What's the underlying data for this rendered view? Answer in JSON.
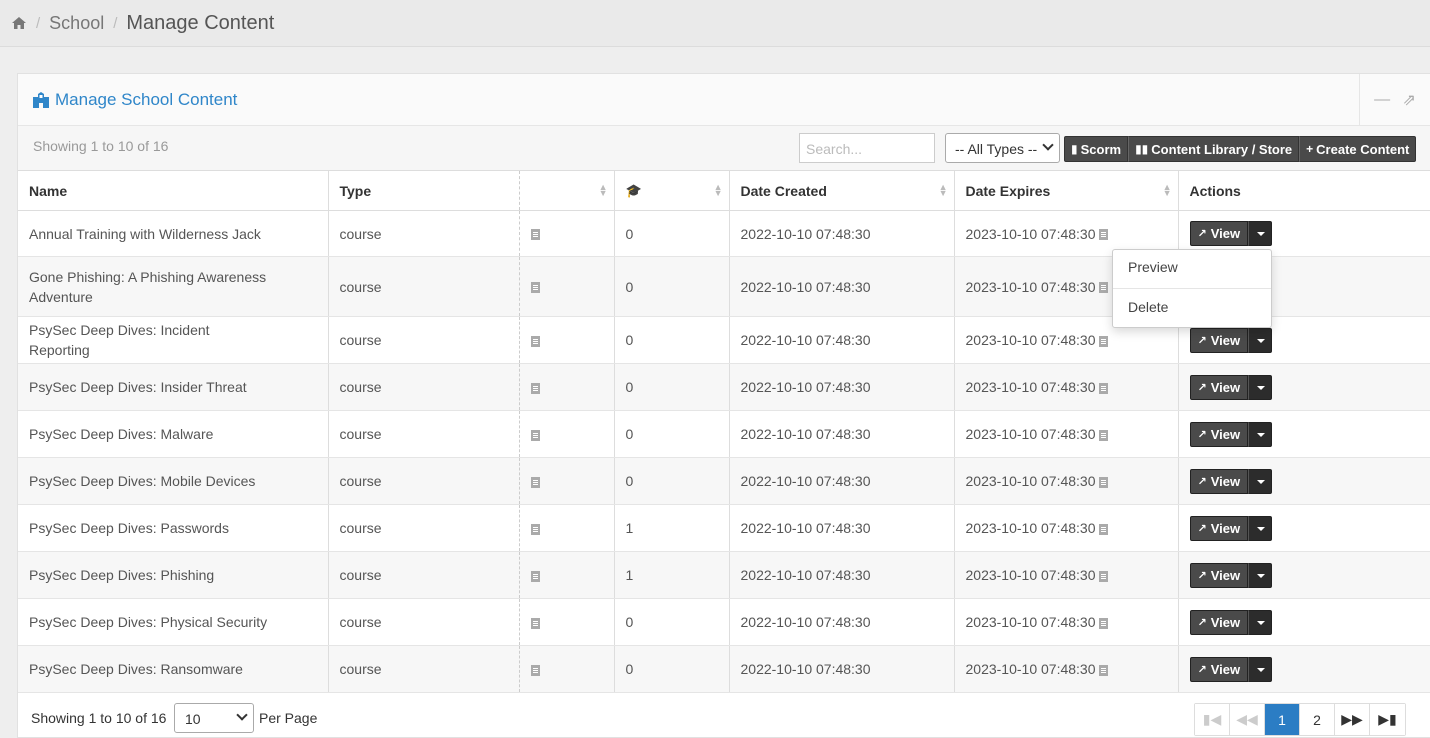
{
  "breadcrumb": {
    "items": [
      "School",
      "Manage Content"
    ]
  },
  "panel": {
    "title": "Manage School Content",
    "minimize_icon": "minus-icon",
    "compress_icon": "compress-icon"
  },
  "toolbar": {
    "showing": "Showing 1 to 10 of 16",
    "search_placeholder": "Search...",
    "type_filter": "-- All Types --",
    "buttons": [
      "Scorm",
      "Content Library / Store",
      "Create Content"
    ]
  },
  "table": {
    "headers": {
      "name": "Name",
      "type": "Type",
      "file": "",
      "enrolled_icon": "graduation-cap-icon",
      "date_created": "Date Created",
      "date_expires": "Date Expires",
      "actions": "Actions"
    },
    "view_label": "View",
    "rows": [
      {
        "name": "Annual Training with Wilderness Jack",
        "type": "course",
        "count": "0",
        "created": "2022-10-10 07:48:30",
        "expires": "2023-10-10 07:48:30"
      },
      {
        "name": "Gone Phishing: A Phishing Awareness Adventure",
        "type": "course",
        "count": "0",
        "created": "2022-10-10 07:48:30",
        "expires": "2023-10-10 07:48:30"
      },
      {
        "name": "PsySec Deep Dives: Incident Reporting",
        "type": "course",
        "count": "0",
        "created": "2022-10-10 07:48:30",
        "expires": "2023-10-10 07:48:30"
      },
      {
        "name": "PsySec Deep Dives: Insider Threat",
        "type": "course",
        "count": "0",
        "created": "2022-10-10 07:48:30",
        "expires": "2023-10-10 07:48:30"
      },
      {
        "name": "PsySec Deep Dives: Malware",
        "type": "course",
        "count": "0",
        "created": "2022-10-10 07:48:30",
        "expires": "2023-10-10 07:48:30"
      },
      {
        "name": "PsySec Deep Dives: Mobile Devices",
        "type": "course",
        "count": "0",
        "created": "2022-10-10 07:48:30",
        "expires": "2023-10-10 07:48:30"
      },
      {
        "name": "PsySec Deep Dives: Passwords",
        "type": "course",
        "count": "1",
        "created": "2022-10-10 07:48:30",
        "expires": "2023-10-10 07:48:30"
      },
      {
        "name": "PsySec Deep Dives: Phishing",
        "type": "course",
        "count": "1",
        "created": "2022-10-10 07:48:30",
        "expires": "2023-10-10 07:48:30"
      },
      {
        "name": "PsySec Deep Dives: Physical Security",
        "type": "course",
        "count": "0",
        "created": "2022-10-10 07:48:30",
        "expires": "2023-10-10 07:48:30"
      },
      {
        "name": "PsySec Deep Dives: Ransomware",
        "type": "course",
        "count": "0",
        "created": "2022-10-10 07:48:30",
        "expires": "2023-10-10 07:48:30"
      }
    ]
  },
  "dropdown": {
    "items": [
      "Preview",
      "Delete"
    ]
  },
  "footer": {
    "showing": "Showing 1 to 10 of 16",
    "per_page_value": "10",
    "per_page_label": "Per Page",
    "pages": [
      "1",
      "2"
    ],
    "active_page": "1"
  },
  "colors": {
    "accent": "#2b7dc4",
    "dark_button": "#4a4a4a"
  }
}
